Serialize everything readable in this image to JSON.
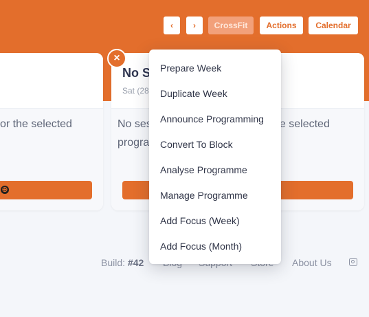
{
  "toolbar": {
    "prev_glyph": "‹",
    "next_glyph": "›",
    "program_label": "CrossFit",
    "actions_label": "Actions",
    "calendar_label": "Calendar"
  },
  "cards": [
    {
      "message_line1": "or the selected",
      "message_line2": "",
      "add_icon": "⊕"
    },
    {
      "title": "No Se",
      "subtitle": "Sat (28",
      "message_line1": "No ses",
      "message_line2": "progra",
      "message_tail1": "ne selected",
      "close_glyph": "×"
    }
  ],
  "actions_menu": {
    "items": [
      "Prepare Week",
      "Duplicate Week",
      "Announce Programming",
      "Convert To Block",
      "Analyse Programme",
      "Manage Programme",
      "Add Focus (Week)",
      "Add Focus (Month)"
    ]
  },
  "footer": {
    "build_label": "Build:",
    "build_number": "#42",
    "blog": "Blog",
    "support": "Support",
    "store": "Store",
    "about": "About Us",
    "social_icon": "instagram-icon"
  },
  "colors": {
    "brand": "#e36e2c",
    "background": "#f4f6fa"
  }
}
